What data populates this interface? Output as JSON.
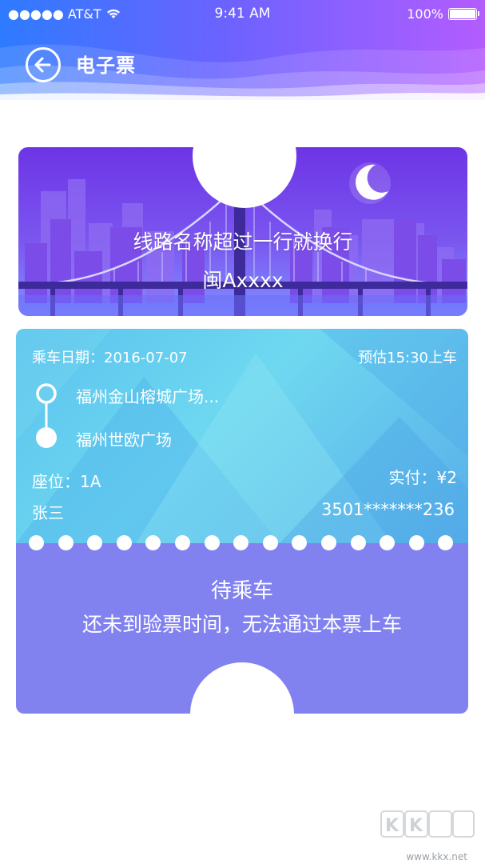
{
  "status_bar": {
    "carrier": "●●●●● AT&T",
    "time": "9:41 AM",
    "battery": "100%"
  },
  "header": {
    "title": "电子票",
    "back_icon": "back-arrow-circle-icon"
  },
  "route": {
    "name": "线路名称超过一行就换行",
    "plate": "闽Axxxx"
  },
  "ticket": {
    "date_label": "乘车日期：2016-07-07",
    "estimated_board": "预估15:30上车",
    "from_stop": "福州金山榕城广场...",
    "to_stop": "福州世欧广场",
    "seat": "座位：1A",
    "paid": "实付：¥2",
    "passenger": "张三",
    "id_number": "3501*******236"
  },
  "status": {
    "title": "待乘车",
    "message": "还未到验票时间，无法通过本票上车"
  },
  "watermark": {
    "logo": "KK下载",
    "url": "www.kkx.net"
  },
  "colors": {
    "header_start": "#2e7bff",
    "header_end": "#b35cff",
    "info_card": "#5ac2ee",
    "status_card": "#8182f0"
  }
}
